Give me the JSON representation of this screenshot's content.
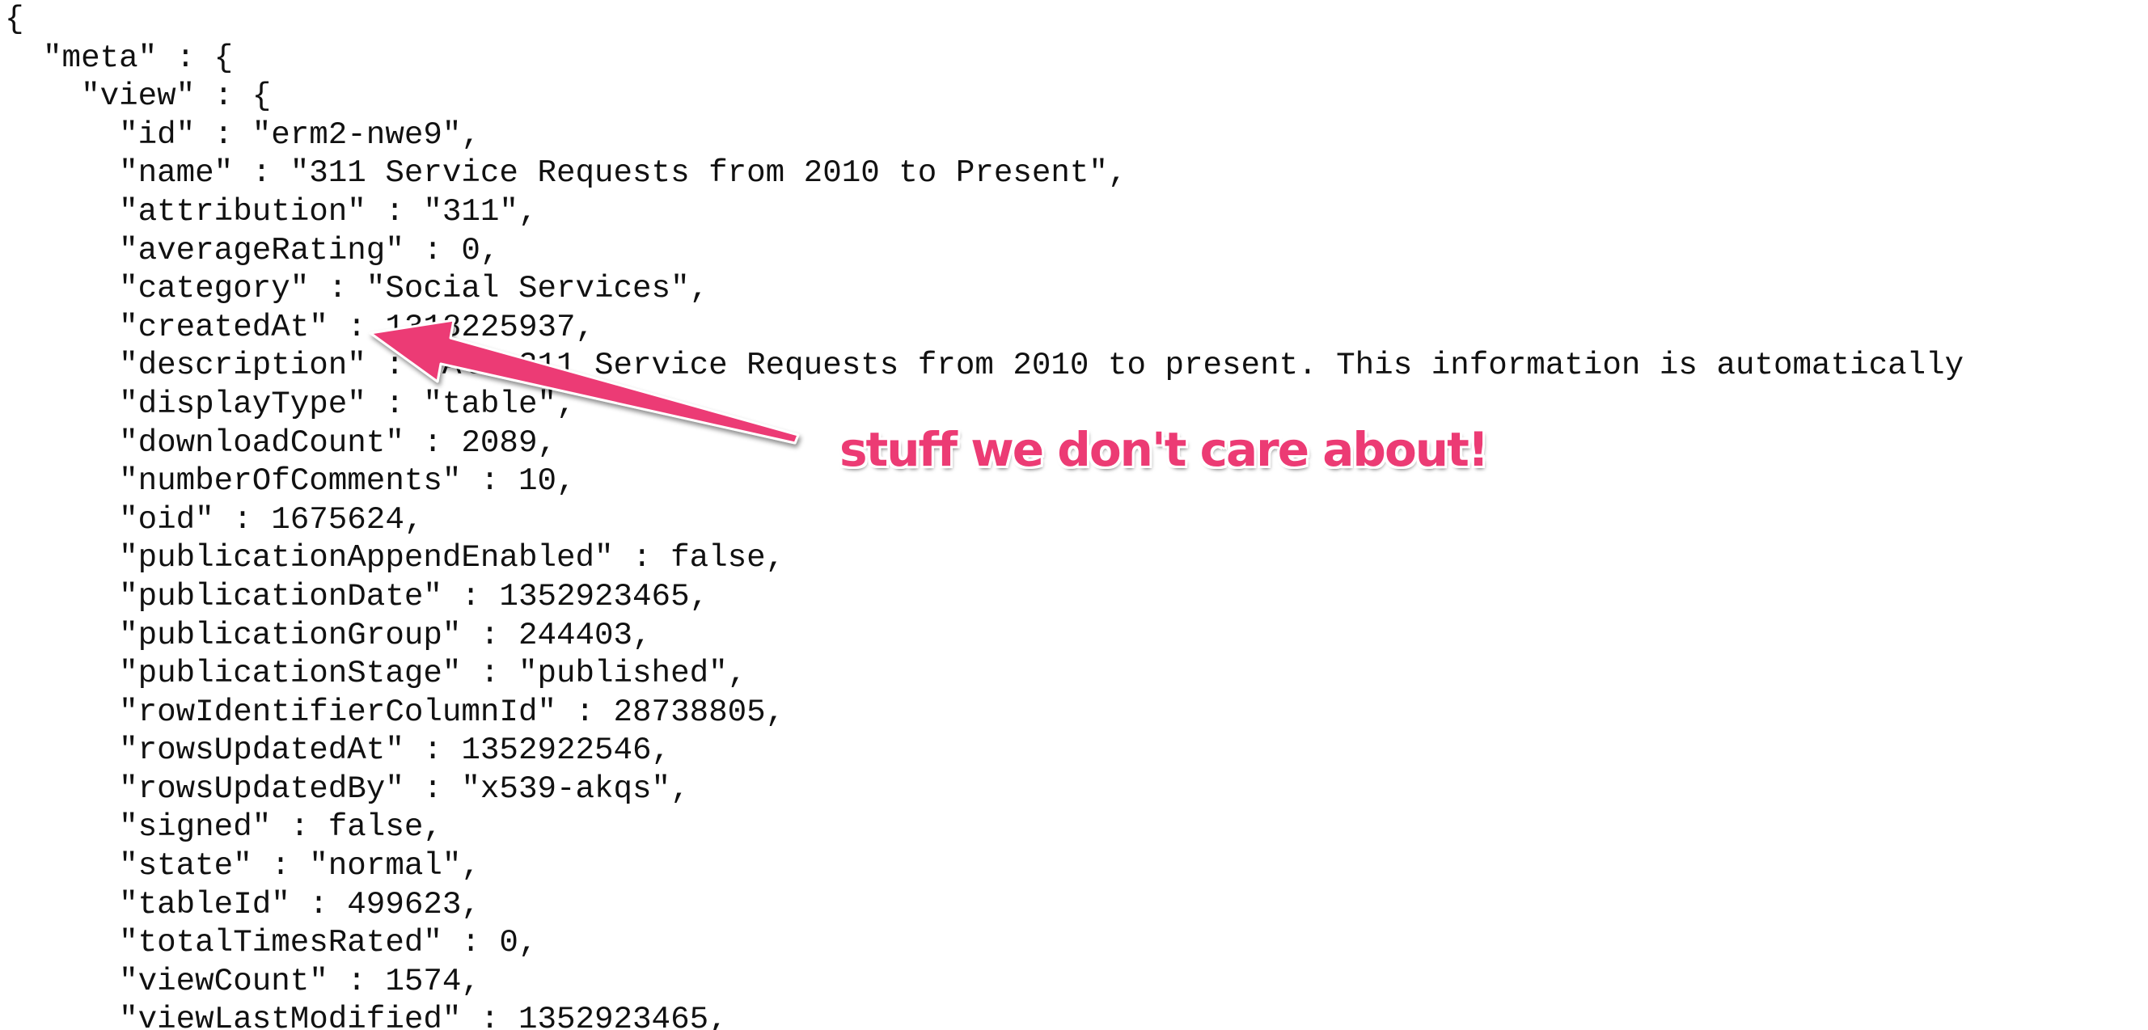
{
  "json_lines": [
    "{",
    "  \"meta\" : {",
    "    \"view\" : {",
    "      \"id\" : \"erm2-nwe9\",",
    "      \"name\" : \"311 Service Requests from 2010 to Present\",",
    "      \"attribution\" : \"311\",",
    "      \"averageRating\" : 0,",
    "      \"category\" : \"Social Services\",",
    "      \"createdAt\" : 1318225937,",
    "      \"description\" : \"All 311 Service Requests from 2010 to present. This information is automatically",
    "      \"displayType\" : \"table\",",
    "      \"downloadCount\" : 2089,",
    "      \"numberOfComments\" : 10,",
    "      \"oid\" : 1675624,",
    "      \"publicationAppendEnabled\" : false,",
    "      \"publicationDate\" : 1352923465,",
    "      \"publicationGroup\" : 244403,",
    "      \"publicationStage\" : \"published\",",
    "      \"rowIdentifierColumnId\" : 28738805,",
    "      \"rowsUpdatedAt\" : 1352922546,",
    "      \"rowsUpdatedBy\" : \"x539-akqs\",",
    "      \"signed\" : false,",
    "      \"state\" : \"normal\",",
    "      \"tableId\" : 499623,",
    "      \"totalTimesRated\" : 0,",
    "      \"viewCount\" : 1574,",
    "      \"viewLastModified\" : 1352923465,"
  ],
  "annotation": {
    "text": "stuff we don't care about!",
    "color": "#ec3b74"
  }
}
